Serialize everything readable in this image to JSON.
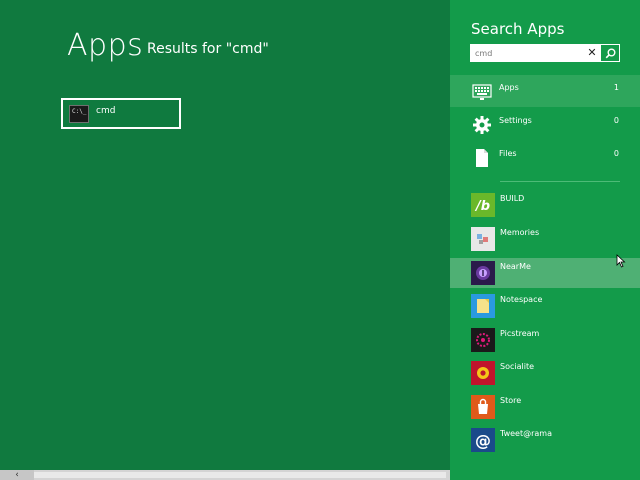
{
  "main": {
    "title": "Apps",
    "subtitle": "Results for \"cmd\"",
    "results": [
      {
        "label": "cmd",
        "icon": "command-prompt-icon"
      }
    ]
  },
  "scrollbar": {
    "left_icon": "‹"
  },
  "pane": {
    "title": "Search Apps",
    "search": {
      "value": "cmd",
      "clear_symbol": "✕"
    },
    "categories": [
      {
        "label": "Apps",
        "count": "1",
        "icon": "keyboard-icon",
        "selected": true
      },
      {
        "label": "Settings",
        "count": "0",
        "icon": "gear-icon"
      },
      {
        "label": "Files",
        "count": "0",
        "icon": "file-icon"
      }
    ],
    "apps": [
      {
        "label": "BUILD",
        "icon": "build-icon",
        "color": "#6ab82a"
      },
      {
        "label": "Memories",
        "icon": "memories-icon",
        "color": "#e8e8e8"
      },
      {
        "label": "NearMe",
        "icon": "nearme-icon",
        "color": "#2a1a4a"
      },
      {
        "label": "Notespace",
        "icon": "notespace-icon",
        "color": "#2a9ae0"
      },
      {
        "label": "Picstream",
        "icon": "picstream-icon",
        "color": "#1a1a1a"
      },
      {
        "label": "Socialite",
        "icon": "socialite-icon",
        "color": "#c0142c"
      },
      {
        "label": "Store",
        "icon": "store-icon",
        "color": "#e05a1a"
      },
      {
        "label": "Tweet@rama",
        "icon": "tweetrama-icon",
        "color": "#1a4a8a"
      }
    ]
  },
  "colors": {
    "main_bg": "#107a3f",
    "pane_bg": "#139b4a",
    "selected_bg": "#2ea65c",
    "hover_bg": "#4fb074"
  }
}
